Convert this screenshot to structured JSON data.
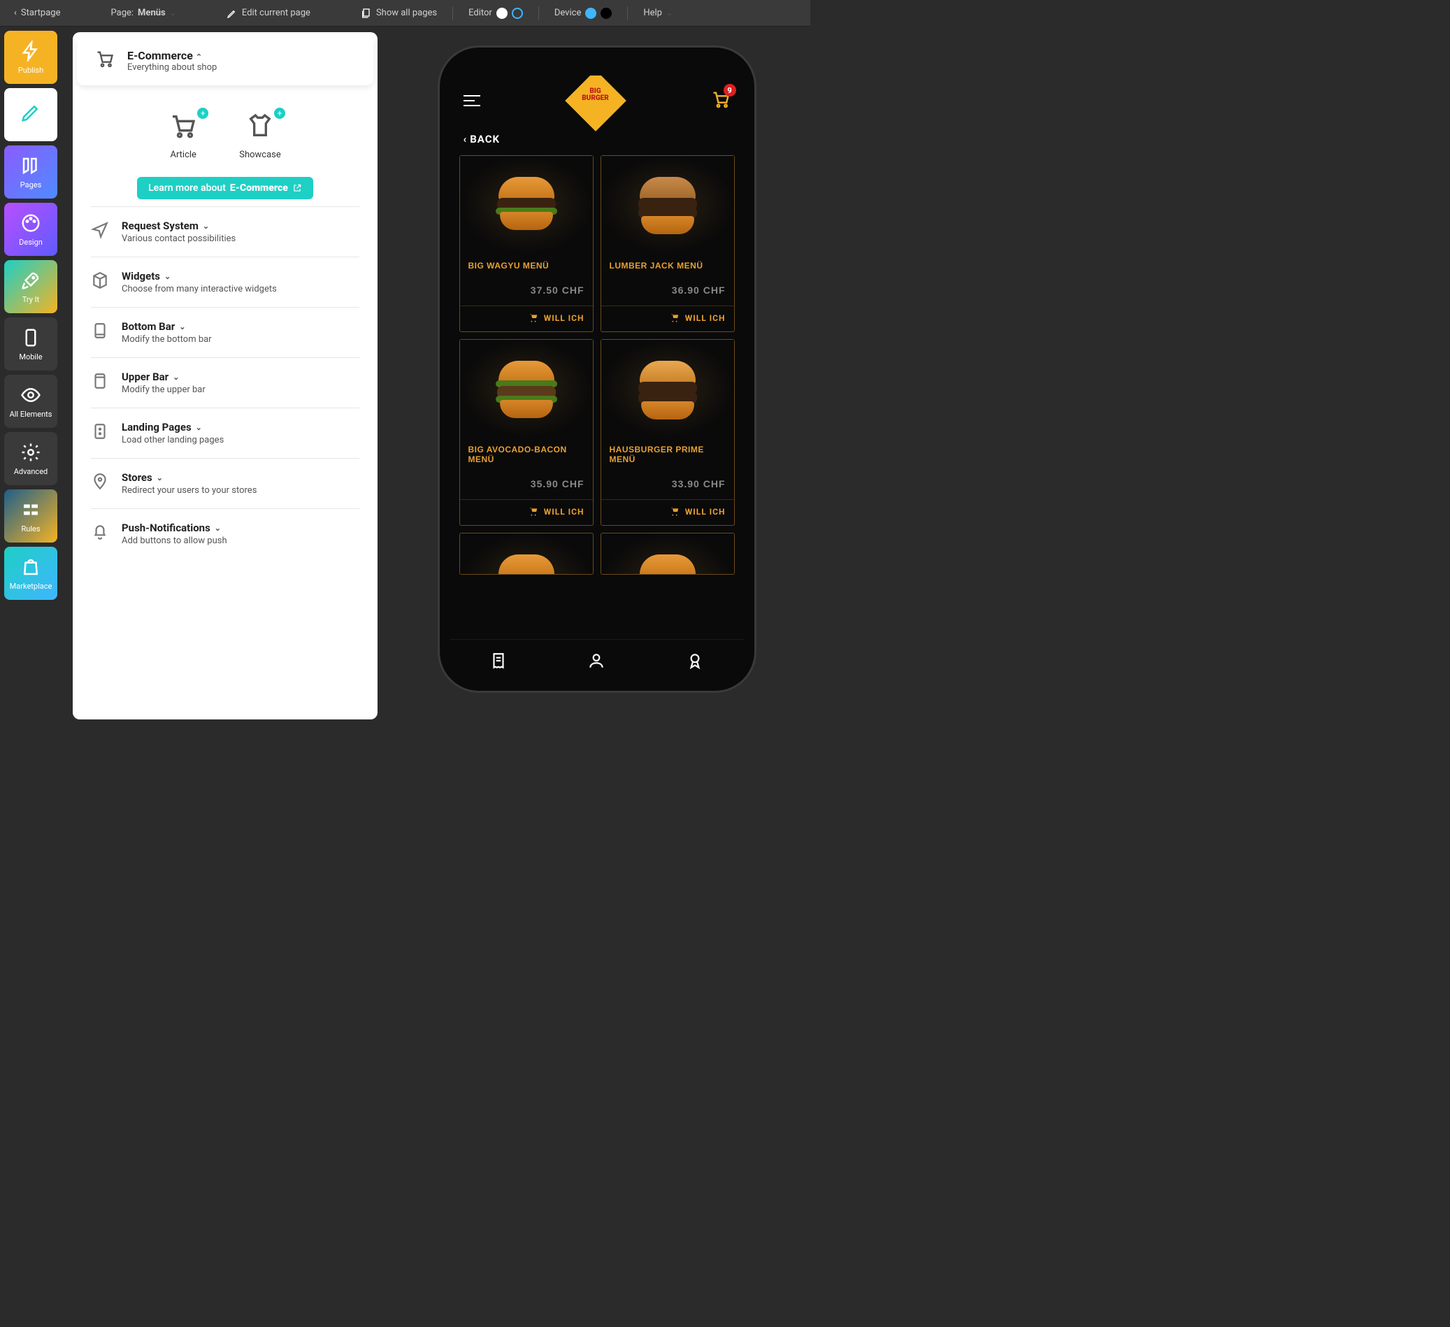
{
  "topbar": {
    "startpage": "Startpage",
    "page_prefix": "Page:",
    "page_name": "Menüs",
    "edit": "Edit current page",
    "showall": "Show all pages",
    "editor": "Editor",
    "device": "Device",
    "help": "Help"
  },
  "siderail": {
    "publish": "Publish",
    "edit": "",
    "pages": "Pages",
    "design": "Design",
    "tryit": "Try It",
    "mobile": "Mobile",
    "all": "All Elements",
    "advanced": "Advanced",
    "rules": "Rules",
    "marketplace": "Marketplace"
  },
  "panel": {
    "head_title": "E-Commerce",
    "head_sub": "Everything about shop",
    "tile_article": "Article",
    "tile_showcase": "Showcase",
    "learn_prefix": "Learn more about ",
    "learn_bold": "E-Commerce",
    "sections": [
      {
        "title": "Request System",
        "sub": "Various contact possibilities"
      },
      {
        "title": "Widgets",
        "sub": "Choose from many interactive widgets"
      },
      {
        "title": "Bottom Bar",
        "sub": "Modify the bottom bar"
      },
      {
        "title": "Upper Bar",
        "sub": "Modify the upper bar"
      },
      {
        "title": "Landing Pages",
        "sub": "Load other landing pages"
      },
      {
        "title": "Stores",
        "sub": "Redirect your users to your stores"
      },
      {
        "title": "Push-Notifications",
        "sub": "Add buttons to allow push"
      }
    ]
  },
  "app": {
    "logo_top": "BIG",
    "logo_bot": "BURGER",
    "cart_badge": "9",
    "back": "BACK",
    "want": "WILL ICH",
    "menu": [
      {
        "name": "BIG WAGYU MENÜ",
        "price": "37.50 CHF"
      },
      {
        "name": "LUMBER JACK MENÜ",
        "price": "36.90 CHF"
      },
      {
        "name": "BIG AVOCADO-BACON MENÜ",
        "price": "35.90 CHF"
      },
      {
        "name": "HAUSBURGER PRIME MENÜ",
        "price": "33.90 CHF"
      }
    ]
  }
}
